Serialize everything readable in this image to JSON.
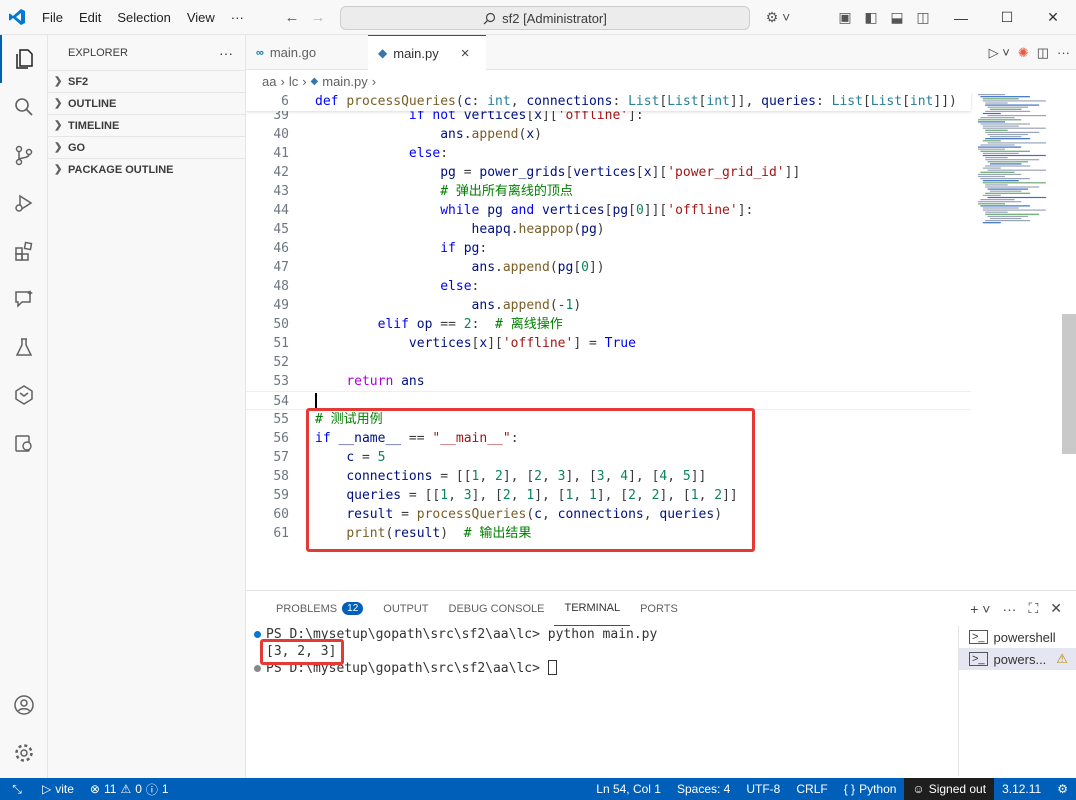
{
  "titlebar": {
    "menu": [
      "File",
      "Edit",
      "Selection",
      "View",
      "···"
    ],
    "command_center": "sf2 [Administrator]"
  },
  "sidebar": {
    "title": "EXPLORER",
    "more": "···",
    "sections": [
      "SF2",
      "OUTLINE",
      "TIMELINE",
      "GO",
      "PACKAGE OUTLINE"
    ]
  },
  "tabs": [
    {
      "label": "main.go",
      "icon": "go-file-icon",
      "active": false
    },
    {
      "label": "main.py",
      "icon": "python-file-icon",
      "active": true,
      "close": "×"
    }
  ],
  "breadcrumb": [
    "aa",
    "lc",
    "main.py"
  ],
  "editor": {
    "sticky": {
      "ln": "6",
      "text": "def processQueries(c: int, connections: List[List[int]], queries: List[List[int]])"
    },
    "lines": [
      {
        "ln": "39",
        "text": "            if not vertices[x]['offline']:"
      },
      {
        "ln": "40",
        "text": "                ans.append(x)"
      },
      {
        "ln": "41",
        "text": "            else:"
      },
      {
        "ln": "42",
        "text": "                pg = power_grids[vertices[x]['power_grid_id']]"
      },
      {
        "ln": "43",
        "text": "                # 弹出所有离线的顶点"
      },
      {
        "ln": "44",
        "text": "                while pg and vertices[pg[0]]['offline']:"
      },
      {
        "ln": "45",
        "text": "                    heapq.heappop(pg)"
      },
      {
        "ln": "46",
        "text": "                if pg:"
      },
      {
        "ln": "47",
        "text": "                    ans.append(pg[0])"
      },
      {
        "ln": "48",
        "text": "                else:"
      },
      {
        "ln": "49",
        "text": "                    ans.append(-1)"
      },
      {
        "ln": "50",
        "text": "        elif op == 2:  # 离线操作"
      },
      {
        "ln": "51",
        "text": "            vertices[x]['offline'] = True"
      },
      {
        "ln": "52",
        "text": ""
      },
      {
        "ln": "53",
        "text": "    return ans"
      },
      {
        "ln": "54",
        "text": ""
      },
      {
        "ln": "55",
        "text": "# 测试用例"
      },
      {
        "ln": "56",
        "text": "if __name__ == \"__main__\":"
      },
      {
        "ln": "57",
        "text": "    c = 5"
      },
      {
        "ln": "58",
        "text": "    connections = [[1, 2], [2, 3], [3, 4], [4, 5]]"
      },
      {
        "ln": "59",
        "text": "    queries = [[1, 3], [2, 1], [1, 1], [2, 2], [1, 2]]"
      },
      {
        "ln": "60",
        "text": "    result = processQueries(c, connections, queries)"
      },
      {
        "ln": "61",
        "text": "    print(result)  # 输出结果"
      }
    ]
  },
  "panel": {
    "tabs": [
      "PROBLEMS",
      "OUTPUT",
      "DEBUG CONSOLE",
      "TERMINAL",
      "PORTS"
    ],
    "problems_count": "12",
    "terminal_lines": [
      "PS D:\\mysetup\\gopath\\src\\sf2\\aa\\lc> python main.py",
      "[3, 2, 3]",
      "PS D:\\mysetup\\gopath\\src\\sf2\\aa\\lc> "
    ],
    "terminals": [
      "powershell",
      "powers..."
    ]
  },
  "statusbar": {
    "branch": "vite",
    "errors": "11",
    "warnings": "0",
    "info": "1",
    "position": "Ln 54, Col 1",
    "spaces": "Spaces: 4",
    "encoding": "UTF-8",
    "eol": "CRLF",
    "language": "Python",
    "account": "Signed out",
    "version": "3.12.11"
  },
  "colors": {
    "accent": "#005fb8",
    "highlight_box": "#e53935"
  }
}
